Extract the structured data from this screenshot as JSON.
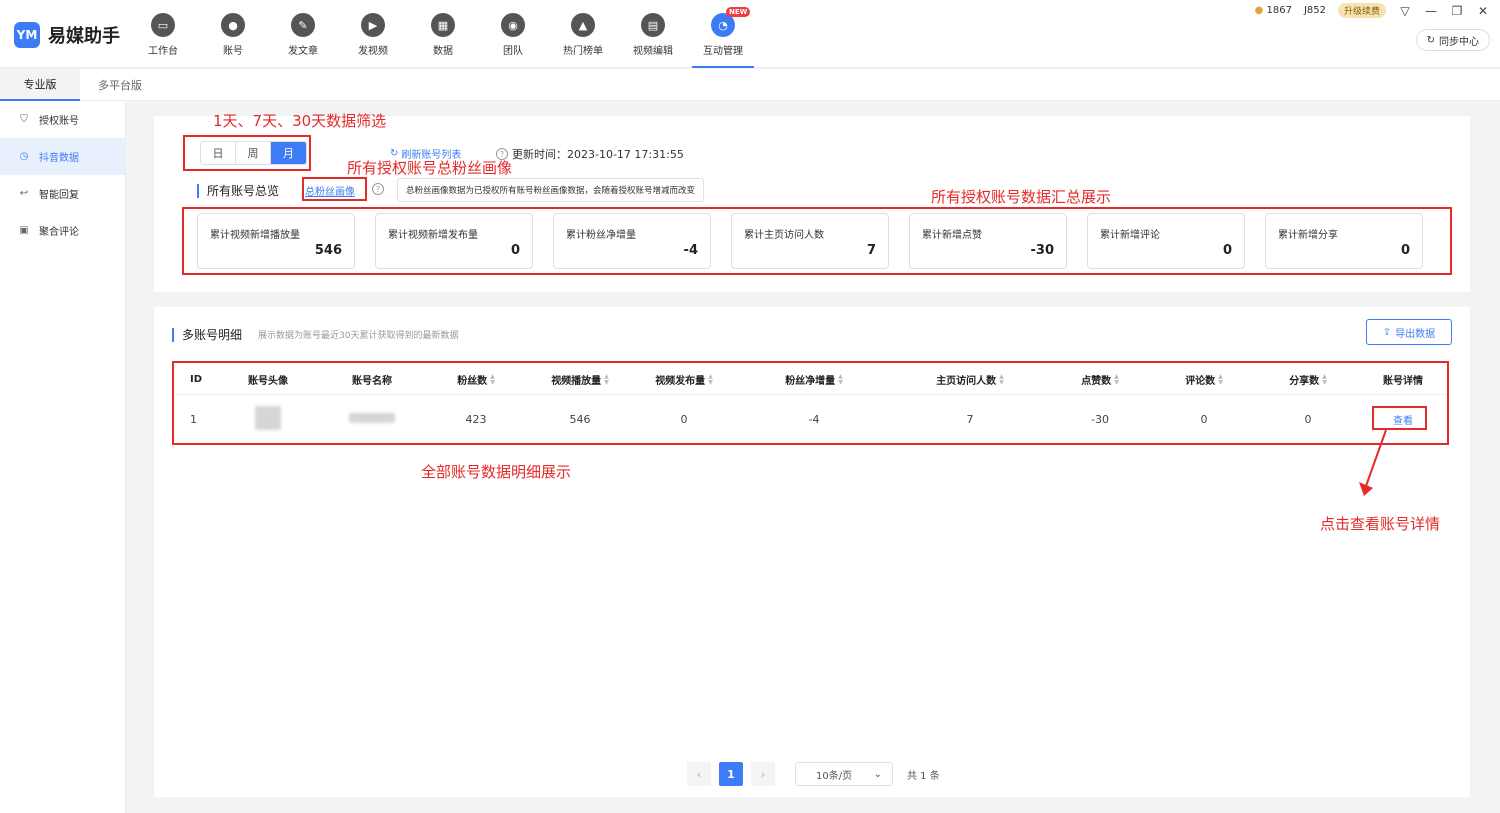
{
  "app": {
    "logo_mark": "YM",
    "title": "易媒助手"
  },
  "nav": [
    {
      "label": "工作台",
      "icon": "monitor-icon",
      "glyph": "▭"
    },
    {
      "label": "账号",
      "icon": "user-icon",
      "glyph": "●"
    },
    {
      "label": "发文章",
      "icon": "quill-icon",
      "glyph": "✎"
    },
    {
      "label": "发视频",
      "icon": "play-icon",
      "glyph": "▶"
    },
    {
      "label": "数据",
      "icon": "chart-icon",
      "glyph": "▦"
    },
    {
      "label": "团队",
      "icon": "team-icon",
      "glyph": "◉"
    },
    {
      "label": "热门榜单",
      "icon": "flame-icon",
      "glyph": "▲"
    },
    {
      "label": "视频编辑",
      "icon": "briefcase-icon",
      "glyph": "▤"
    },
    {
      "label": "互动管理",
      "icon": "chat-icon",
      "glyph": "◔",
      "badge": "NEW",
      "active": true
    }
  ],
  "topright": {
    "coins": "1867",
    "user": "J852",
    "upgrade": "升级续费",
    "sync": "同步中心"
  },
  "version_tabs": [
    {
      "label": "专业版",
      "active": true
    },
    {
      "label": "多平台版"
    }
  ],
  "sidebar": [
    {
      "label": "授权账号",
      "icon": "shield-icon",
      "glyph": "⛉"
    },
    {
      "label": "抖音数据",
      "icon": "gauge-icon",
      "glyph": "◷",
      "active": true
    },
    {
      "label": "智能回复",
      "icon": "reply-icon",
      "glyph": "↩"
    },
    {
      "label": "聚合评论",
      "icon": "comment-icon",
      "glyph": "▣"
    }
  ],
  "overview": {
    "segments": [
      "日",
      "周",
      "月"
    ],
    "active_segment": "月",
    "refresh_label": "刷新账号列表",
    "update_time": "更新时间：2023-10-17 17:31:55",
    "title": "所有账号总览",
    "fan_link": "总粉丝画像",
    "tooltip": "总粉丝画像数据为已授权所有账号粉丝画像数据，会随着授权账号增减而改变",
    "stats": [
      {
        "label": "累计视频新增播放量",
        "value": "546"
      },
      {
        "label": "累计视频新增发布量",
        "value": "0"
      },
      {
        "label": "累计粉丝净增量",
        "value": "-4"
      },
      {
        "label": "累计主页访问人数",
        "value": "7"
      },
      {
        "label": "累计新增点赞",
        "value": "-30"
      },
      {
        "label": "累计新增评论",
        "value": "0"
      },
      {
        "label": "累计新增分享",
        "value": "0"
      }
    ]
  },
  "detail": {
    "title": "多账号明细",
    "desc": "展示数据为账号最近30天累计获取得到的最新数据",
    "export_label": "导出数据",
    "columns": [
      "ID",
      "账号头像",
      "账号名称",
      "粉丝数",
      "视频播放量",
      "视频发布量",
      "粉丝净增量",
      "主页访问人数",
      "点赞数",
      "评论数",
      "分享数",
      "账号详情"
    ],
    "rows": [
      {
        "id": "1",
        "fans": "423",
        "plays": "546",
        "posts": "0",
        "net_fans": "-4",
        "visits": "7",
        "likes": "-30",
        "comments": "0",
        "shares": "0",
        "action": "查看"
      }
    ]
  },
  "pager": {
    "prev": "‹",
    "page": "1",
    "next": "›",
    "size": "10条/页",
    "total": "共 1 条"
  },
  "annotations": {
    "filter": "1天、7天、30天数据筛选",
    "fan_portrait": "所有授权账号总粉丝画像",
    "summary": "所有授权账号数据汇总展示",
    "detail": "全部账号数据明细展示",
    "view": "点击查看账号详情"
  }
}
